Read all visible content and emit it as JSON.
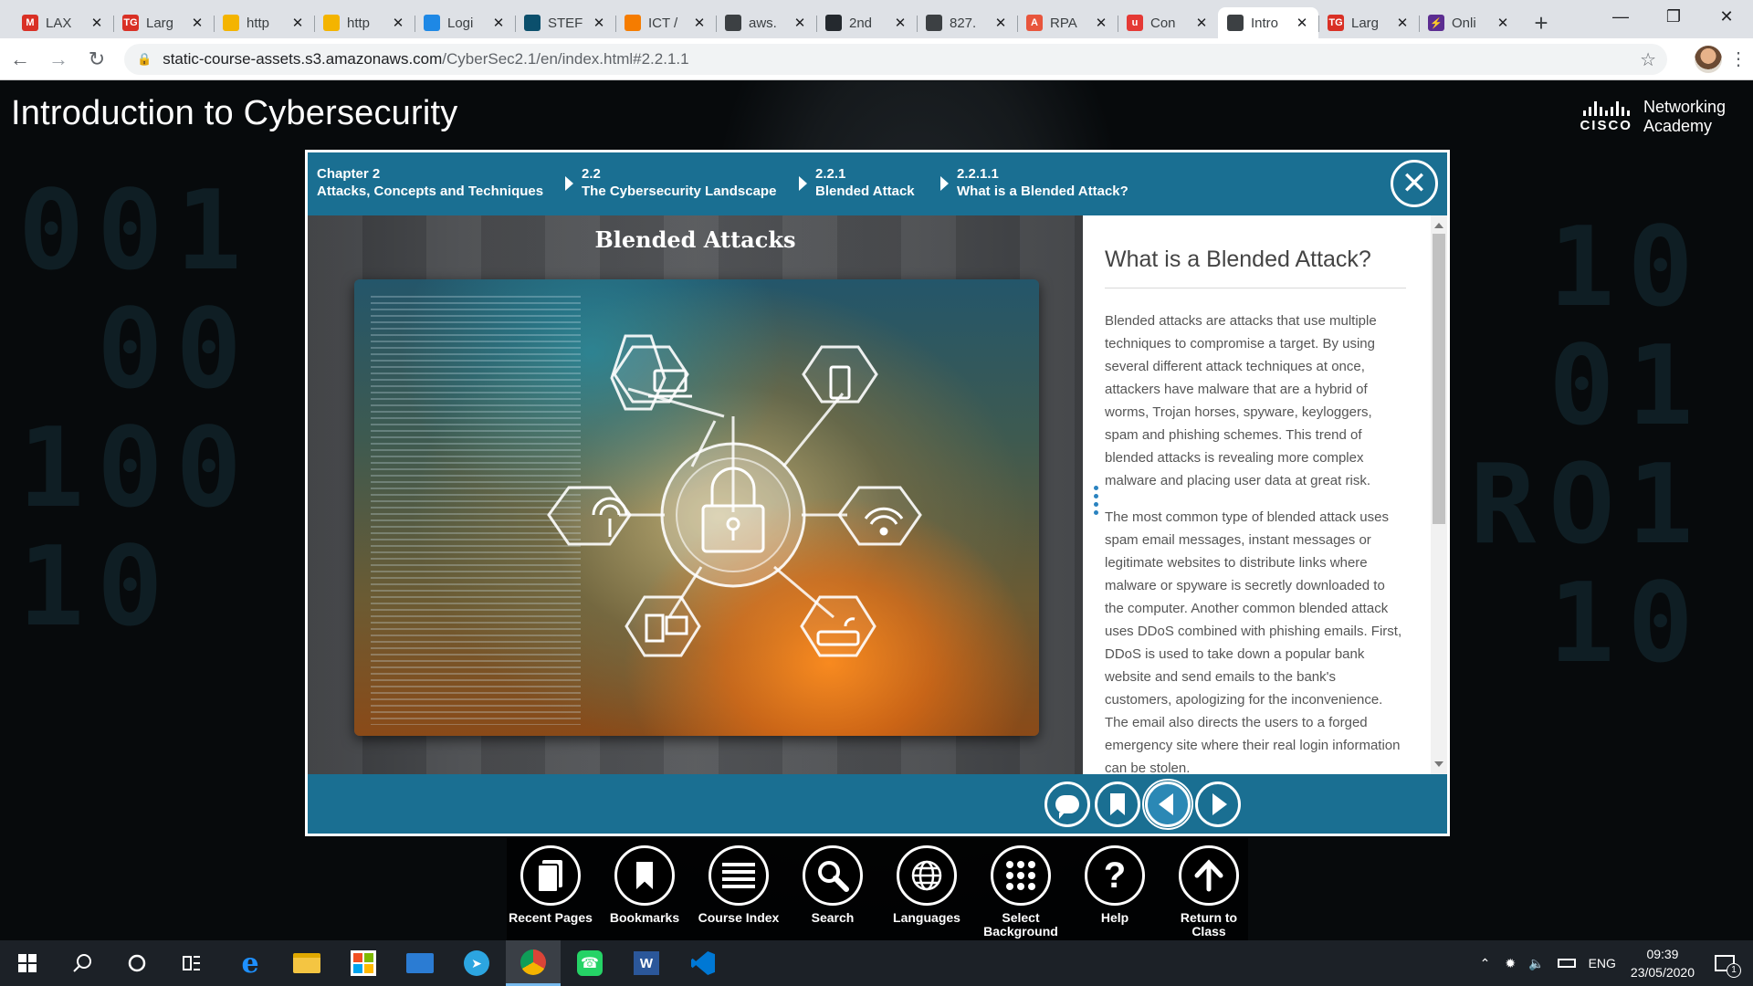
{
  "browser": {
    "tabs": [
      {
        "title": "LAX",
        "favicon": "gmail-icon",
        "color": "#d93025",
        "glyph": "M"
      },
      {
        "title": "Larg",
        "favicon": "tg-icon",
        "color": "#d93025",
        "glyph": "TG"
      },
      {
        "title": "http",
        "favicon": "yellow-icon",
        "color": "#f4b400",
        "glyph": ""
      },
      {
        "title": "http",
        "favicon": "yellow-icon",
        "color": "#f4b400",
        "glyph": ""
      },
      {
        "title": "Logi",
        "favicon": "cloud-icon",
        "color": "#1e88e5",
        "glyph": ""
      },
      {
        "title": "STEF",
        "favicon": "pointer-icon",
        "color": "#0b4f6c",
        "glyph": ""
      },
      {
        "title": "ICT /",
        "favicon": "ict-icon",
        "color": "#f57c00",
        "glyph": ""
      },
      {
        "title": "aws.",
        "favicon": "globe-icon",
        "color": "#3c4043",
        "glyph": ""
      },
      {
        "title": "2nd",
        "favicon": "github-icon",
        "color": "#24292e",
        "glyph": ""
      },
      {
        "title": "827.",
        "favicon": "globe-icon",
        "color": "#3c4043",
        "glyph": ""
      },
      {
        "title": "RPA",
        "favicon": "rpa-icon",
        "color": "#e8553c",
        "glyph": "A"
      },
      {
        "title": "Con",
        "favicon": "u-icon",
        "color": "#e53935",
        "glyph": "u"
      },
      {
        "title": "Intro",
        "favicon": "globe-icon",
        "color": "#3c4043",
        "glyph": "",
        "active": true
      },
      {
        "title": "Larg",
        "favicon": "tg-icon",
        "color": "#d93025",
        "glyph": "TG"
      },
      {
        "title": "Onli",
        "favicon": "bolt-icon",
        "color": "#5c2d91",
        "glyph": "⚡"
      }
    ],
    "url_host": "static-course-assets.s3.amazonaws.com",
    "url_path": "/CyberSec2.1/en/index.html#2.2.1.1"
  },
  "course": {
    "title": "Introduction to Cybersecurity",
    "brand_word": "CISCO",
    "brand_line1": "Networking",
    "brand_line2": "Academy"
  },
  "modal": {
    "breadcrumbs": [
      {
        "num": "Chapter 2",
        "label": "Attacks, Concepts and Techniques"
      },
      {
        "num": "2.2",
        "label": "The Cybersecurity Landscape"
      },
      {
        "num": "2.2.1",
        "label": "Blended Attack"
      },
      {
        "num": "2.2.1.1",
        "label": "What is a Blended Attack?"
      }
    ],
    "image_title": "Blended Attacks",
    "content_title": "What is a Blended Attack?",
    "paragraphs": [
      "Blended attacks are attacks that use multiple techniques to compromise a target. By using several different attack techniques at once, attackers have malware that are a hybrid of worms, Trojan horses, spyware, keyloggers, spam and phishing schemes. This trend of blended attacks is revealing more complex malware and placing user data at great risk.",
      "The most common type of blended attack uses spam email messages, instant messages or legitimate websites to distribute links where malware or spyware is secretly downloaded to the computer. Another common blended attack uses DDoS combined with phishing emails. First, DDoS is used to take down a popular bank website and send emails to the bank's customers, apologizing for the inconvenience. The email also directs the users to a forged emergency site where their real login information can be stolen."
    ],
    "accent_color": "#1a6f92"
  },
  "bottom_nav": [
    {
      "label": "Recent Pages",
      "icon": "recent-pages-icon"
    },
    {
      "label": "Bookmarks",
      "icon": "bookmark-icon"
    },
    {
      "label": "Course Index",
      "icon": "list-icon"
    },
    {
      "label": "Search",
      "icon": "search-icon"
    },
    {
      "label": "Languages",
      "icon": "globe-icon"
    },
    {
      "label": "Select Background",
      "icon": "grid-dots-icon"
    },
    {
      "label": "Help",
      "icon": "help-icon"
    },
    {
      "label": "Return to Class",
      "icon": "arrow-up-icon"
    }
  ],
  "taskbar": {
    "language": "ENG",
    "time": "09:39",
    "date": "23/05/2020",
    "notification_count": "1"
  }
}
